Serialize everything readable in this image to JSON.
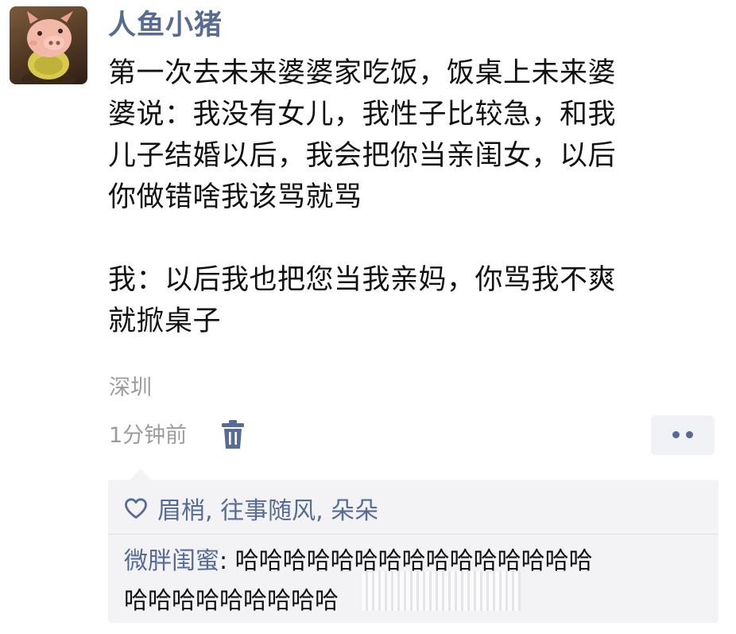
{
  "author": {
    "name": "人鱼小猪"
  },
  "post": {
    "paragraph1_lines": [
      "第一次去未来婆婆家吃饭，饭桌上未来婆",
      "婆说：我没有女儿，我性子比较急，和我",
      "儿子结婚以后，我会把你当亲闺女，以后",
      "你做错啥我该骂就骂"
    ],
    "paragraph2_lines": [
      "我：以后我也把您当我亲妈，你骂我不爽",
      "就掀桌子"
    ]
  },
  "meta": {
    "location": "深圳",
    "time": "1分钟前",
    "delete_icon": "trash-icon",
    "more_icon": "two-dots-icon"
  },
  "likes": {
    "icon": "heart-outline-icon",
    "users": "眉梢, 往事随风, 朵朵"
  },
  "comment": {
    "author": "微胖闺蜜",
    "separator": ": ",
    "line1": "哈哈哈哈哈哈哈哈哈哈哈哈哈哈哈",
    "line2": "哈哈哈哈哈哈哈哈哈"
  },
  "colors": {
    "link_blue": "#576b95",
    "text": "#111111",
    "muted_gray": "#9c9c9c",
    "comment_bg": "#f3f3f5"
  }
}
